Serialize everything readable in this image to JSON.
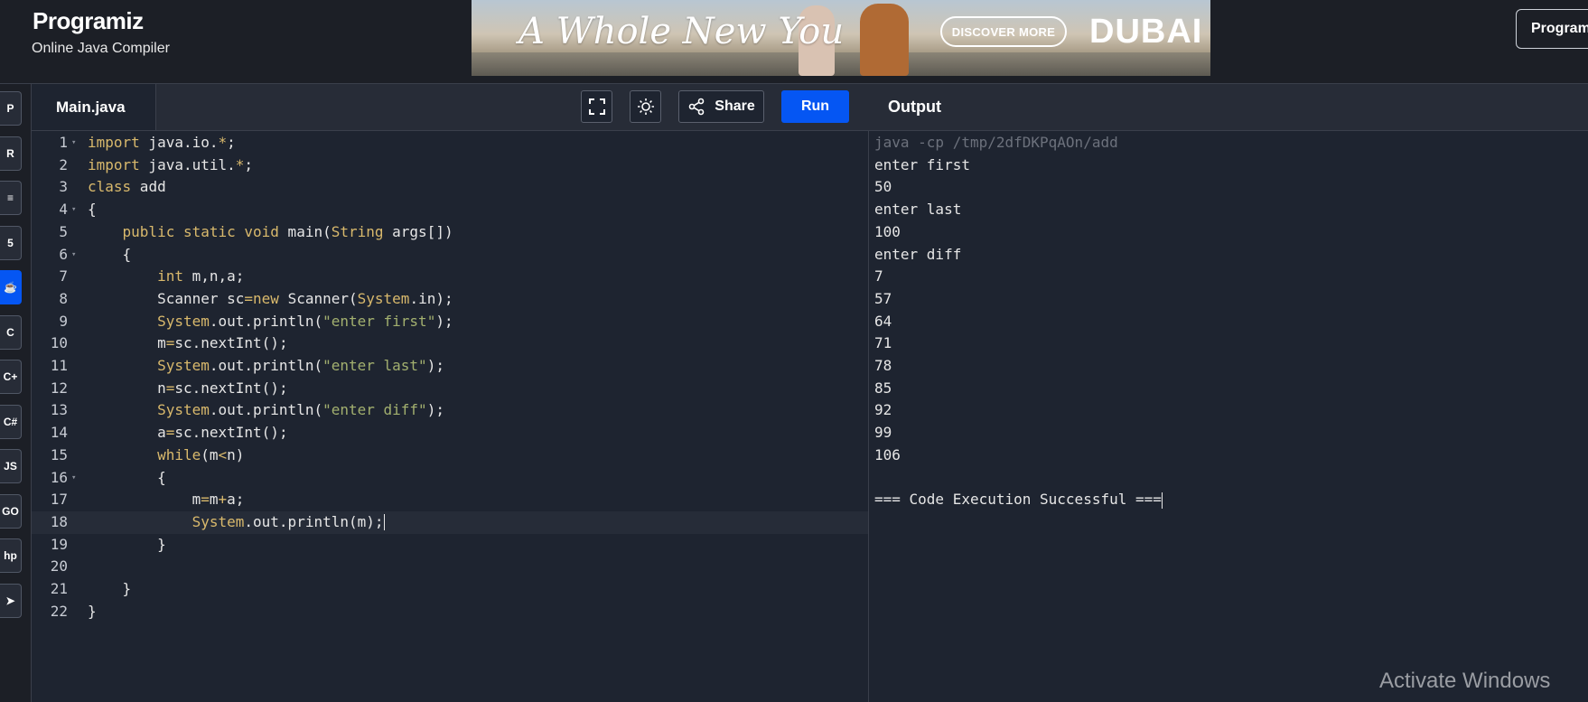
{
  "header": {
    "logo": "Programiz",
    "subtitle": "Online Java Compiler",
    "programiz_pro_label": "Program",
    "ad": {
      "tagline": "A Whole New You",
      "cta": "DISCOVER MORE",
      "brand": "DUBAI"
    }
  },
  "sidebar": {
    "icons": [
      {
        "name": "python-icon",
        "glyph": "P"
      },
      {
        "name": "r-icon",
        "glyph": "R"
      },
      {
        "name": "sql-icon",
        "glyph": "≡"
      },
      {
        "name": "html-icon",
        "glyph": "5"
      },
      {
        "name": "java-icon",
        "glyph": "☕",
        "active": true
      },
      {
        "name": "c-icon",
        "glyph": "C"
      },
      {
        "name": "cpp-icon",
        "glyph": "C+"
      },
      {
        "name": "csharp-icon",
        "glyph": "C#"
      },
      {
        "name": "js-icon",
        "glyph": "JS"
      },
      {
        "name": "go-icon",
        "glyph": "GO"
      },
      {
        "name": "php-icon",
        "glyph": "hp"
      },
      {
        "name": "swift-icon",
        "glyph": "➤"
      }
    ]
  },
  "toolbar": {
    "file_tab": "Main.java",
    "share_label": "Share",
    "run_label": "Run",
    "output_label": "Output"
  },
  "editor": {
    "active_line": 18,
    "lines": [
      {
        "n": "1",
        "fold": true,
        "html": "<span class=\"kw\">import</span> java.io.<span class=\"op\">*</span>;"
      },
      {
        "n": "2",
        "html": "<span class=\"kw\">import</span> java.util.<span class=\"op\">*</span>;"
      },
      {
        "n": "3",
        "html": "<span class=\"kw\">class</span> add"
      },
      {
        "n": "4",
        "fold": true,
        "html": "{"
      },
      {
        "n": "5",
        "html": "    <span class=\"kw\">public static void</span> main(<span class=\"kw\">String</span> args[])"
      },
      {
        "n": "6",
        "fold": true,
        "html": "    {"
      },
      {
        "n": "7",
        "html": "        <span class=\"kw\">int</span> m,n,a;"
      },
      {
        "n": "8",
        "html": "        Scanner sc<span class=\"op\">=</span><span class=\"kw\">new</span> Scanner(<span class=\"sys\">System</span>.in);"
      },
      {
        "n": "9",
        "html": "        <span class=\"sys\">System</span>.out.println(<span class=\"str\">\"enter first\"</span>);"
      },
      {
        "n": "10",
        "html": "        m<span class=\"op\">=</span>sc.nextInt();"
      },
      {
        "n": "11",
        "html": "        <span class=\"sys\">System</span>.out.println(<span class=\"str\">\"enter last\"</span>);"
      },
      {
        "n": "12",
        "html": "        n<span class=\"op\">=</span>sc.nextInt();"
      },
      {
        "n": "13",
        "html": "        <span class=\"sys\">System</span>.out.println(<span class=\"str\">\"enter diff\"</span>);"
      },
      {
        "n": "14",
        "html": "        a<span class=\"op\">=</span>sc.nextInt();"
      },
      {
        "n": "15",
        "html": "        <span class=\"kw\">while</span>(m<span class=\"op\">&lt;</span>n)"
      },
      {
        "n": "16",
        "fold": true,
        "html": "        {"
      },
      {
        "n": "17",
        "html": "            m<span class=\"op\">=</span>m<span class=\"op\">+</span>a;"
      },
      {
        "n": "18",
        "html": "            <span class=\"sys\">System</span>.out.println(m);"
      },
      {
        "n": "19",
        "html": "        }"
      },
      {
        "n": "20",
        "html": ""
      },
      {
        "n": "21",
        "html": "    }"
      },
      {
        "n": "22",
        "html": "}"
      }
    ]
  },
  "output": {
    "command": "java -cp /tmp/2dfDKPqAOn/add",
    "lines": [
      "enter first",
      "50",
      "enter last",
      "100",
      "enter diff",
      "7",
      "57",
      "64",
      "71",
      "78",
      "85",
      "92",
      "99",
      "106",
      "",
      "=== Code Execution Successful ==="
    ]
  },
  "watermark": "Activate Windows"
}
